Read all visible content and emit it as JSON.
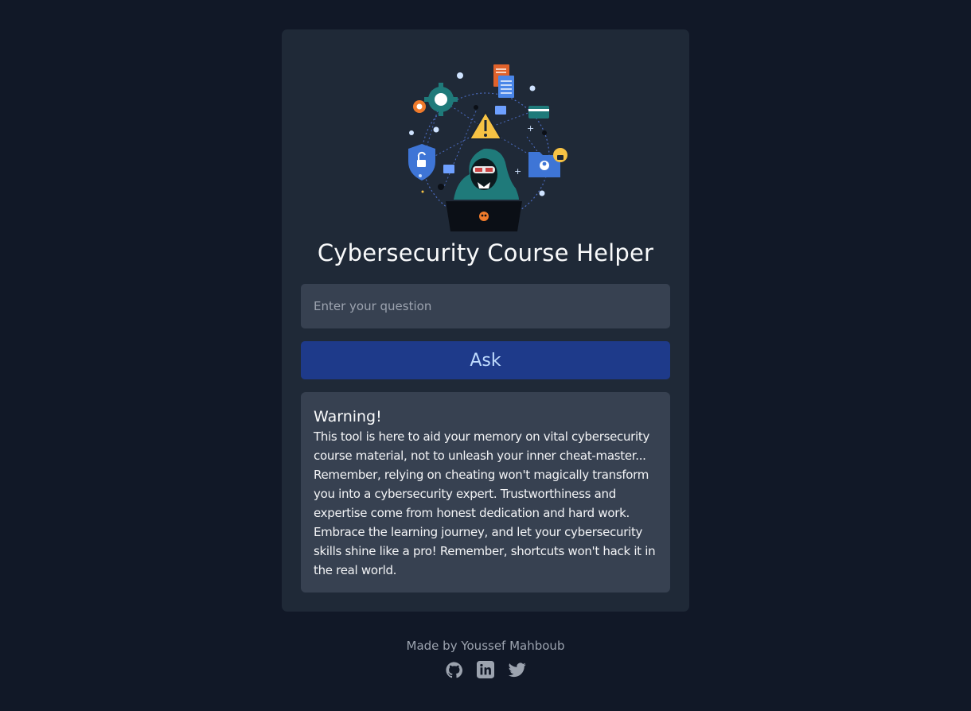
{
  "app": {
    "title": "Cybersecurity Course Helper"
  },
  "hero": {
    "icon": "hacker-illustration"
  },
  "question": {
    "placeholder": "Enter your question",
    "value": ""
  },
  "ask_button": {
    "label": "Ask"
  },
  "warning": {
    "title": "Warning!",
    "body": "This tool is here to aid your memory on vital cybersecurity course material, not to unleash your inner cheat-master... Remember, relying on cheating won't magically transform you into a cybersecurity expert. Trustworthiness and expertise come from honest dedication and hard work. Embrace the learning journey, and let your cybersecurity skills shine like a pro! Remember, shortcuts won't hack it in the real world."
  },
  "footer": {
    "credit": "Made by Youssef Mahboub",
    "socials": [
      {
        "icon": "github-icon"
      },
      {
        "icon": "linkedin-icon"
      },
      {
        "icon": "twitter-icon"
      }
    ]
  },
  "colors": {
    "page_bg": "#111827",
    "card_bg": "#1f2937",
    "input_bg": "#374151",
    "button_bg": "#1e3a8a",
    "button_text": "#bfdbfe"
  }
}
